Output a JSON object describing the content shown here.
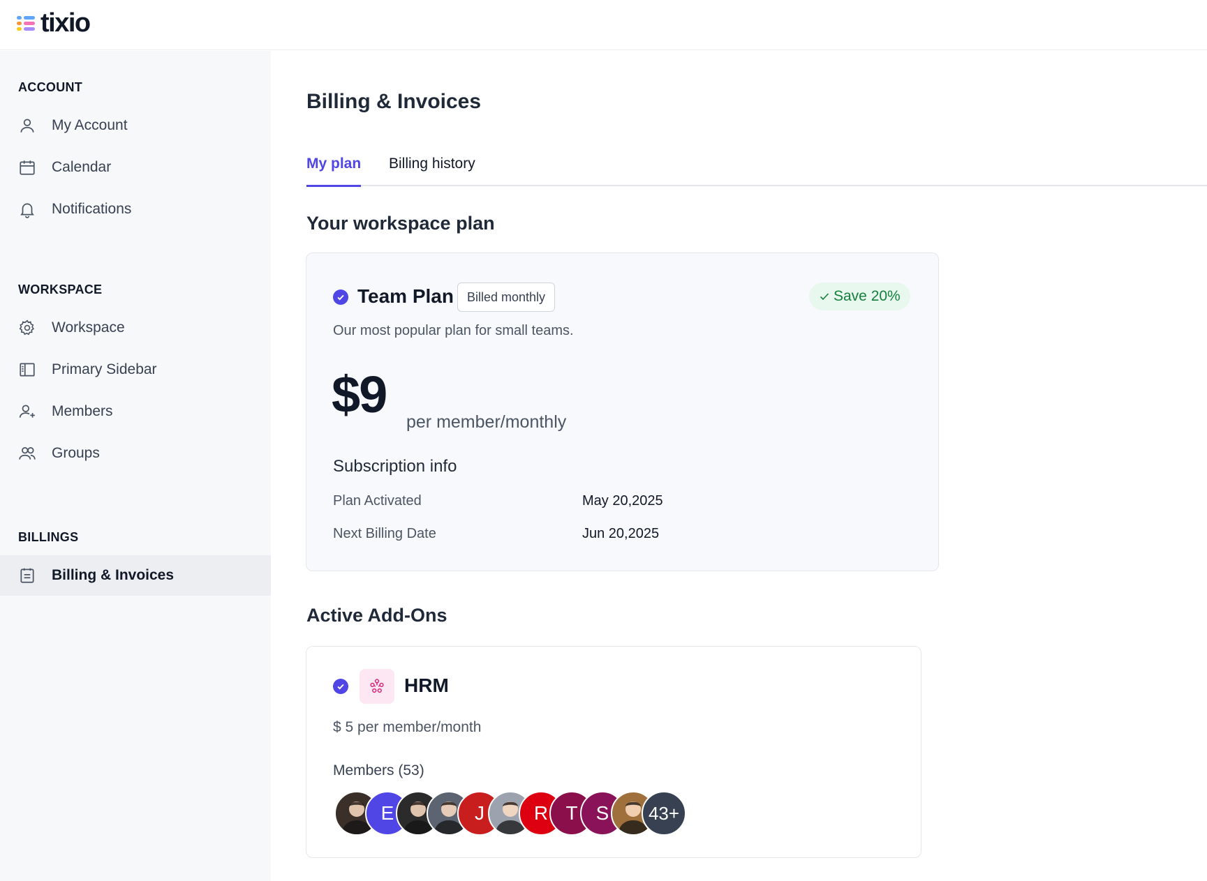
{
  "app": {
    "brand": "tixio"
  },
  "sidebar": {
    "sections": [
      {
        "heading": "ACCOUNT",
        "items": [
          {
            "label": "My Account",
            "icon": "user-icon"
          },
          {
            "label": "Calendar",
            "icon": "calendar-icon"
          },
          {
            "label": "Notifications",
            "icon": "bell-icon"
          }
        ]
      },
      {
        "heading": "WORKSPACE",
        "items": [
          {
            "label": "Workspace",
            "icon": "gear-icon"
          },
          {
            "label": "Primary Sidebar",
            "icon": "sidebar-icon"
          },
          {
            "label": "Members",
            "icon": "user-plus-icon"
          },
          {
            "label": "Groups",
            "icon": "users-icon"
          }
        ]
      },
      {
        "heading": "BILLINGS",
        "items": [
          {
            "label": "Billing & Invoices",
            "icon": "invoice-icon",
            "active": true
          }
        ]
      }
    ]
  },
  "main": {
    "title": "Billing & Invoices",
    "tabs": [
      {
        "label": "My plan",
        "active": true
      },
      {
        "label": "Billing history",
        "active": false
      }
    ],
    "workspace_plan": {
      "heading": "Your workspace plan",
      "plan_name": "Team Plan",
      "billing_badge": "Billed monthly",
      "save_badge": "Save 20%",
      "description": "Our most popular plan for small teams.",
      "price": "$9",
      "price_unit": "per member/monthly",
      "subscription": {
        "heading": "Subscription info",
        "rows": [
          {
            "label": "Plan Activated",
            "value": "May 20,2025"
          },
          {
            "label": "Next Billing Date",
            "value": "Jun 20,2025"
          }
        ]
      }
    },
    "addons": {
      "heading": "Active Add-Ons",
      "items": [
        {
          "name": "HRM",
          "icon": "hrm-people-icon",
          "price": "$ 5 per member/month",
          "members_label": "Members (53)",
          "avatars": [
            {
              "type": "photo",
              "color": "#3b2f2a"
            },
            {
              "type": "initial",
              "text": "E",
              "color": "#4f46e5"
            },
            {
              "type": "photo",
              "color": "#2b2b2b"
            },
            {
              "type": "photo",
              "color": "#5b6470"
            },
            {
              "type": "initial",
              "text": "J",
              "color": "#c81e1e"
            },
            {
              "type": "photo",
              "color": "#9ca3af"
            },
            {
              "type": "initial",
              "text": "R",
              "color": "#dc0010"
            },
            {
              "type": "initial",
              "text": "T",
              "color": "#8b0f4b"
            },
            {
              "type": "initial",
              "text": "S",
              "color": "#8a1258"
            },
            {
              "type": "photo",
              "color": "#a0703c"
            },
            {
              "type": "more",
              "text": "43+",
              "color": "#374151"
            }
          ]
        }
      ]
    }
  },
  "colors": {
    "accent": "#4f46e5",
    "save_green": "#15803d",
    "sidebar_bg": "#f7f8fa"
  }
}
